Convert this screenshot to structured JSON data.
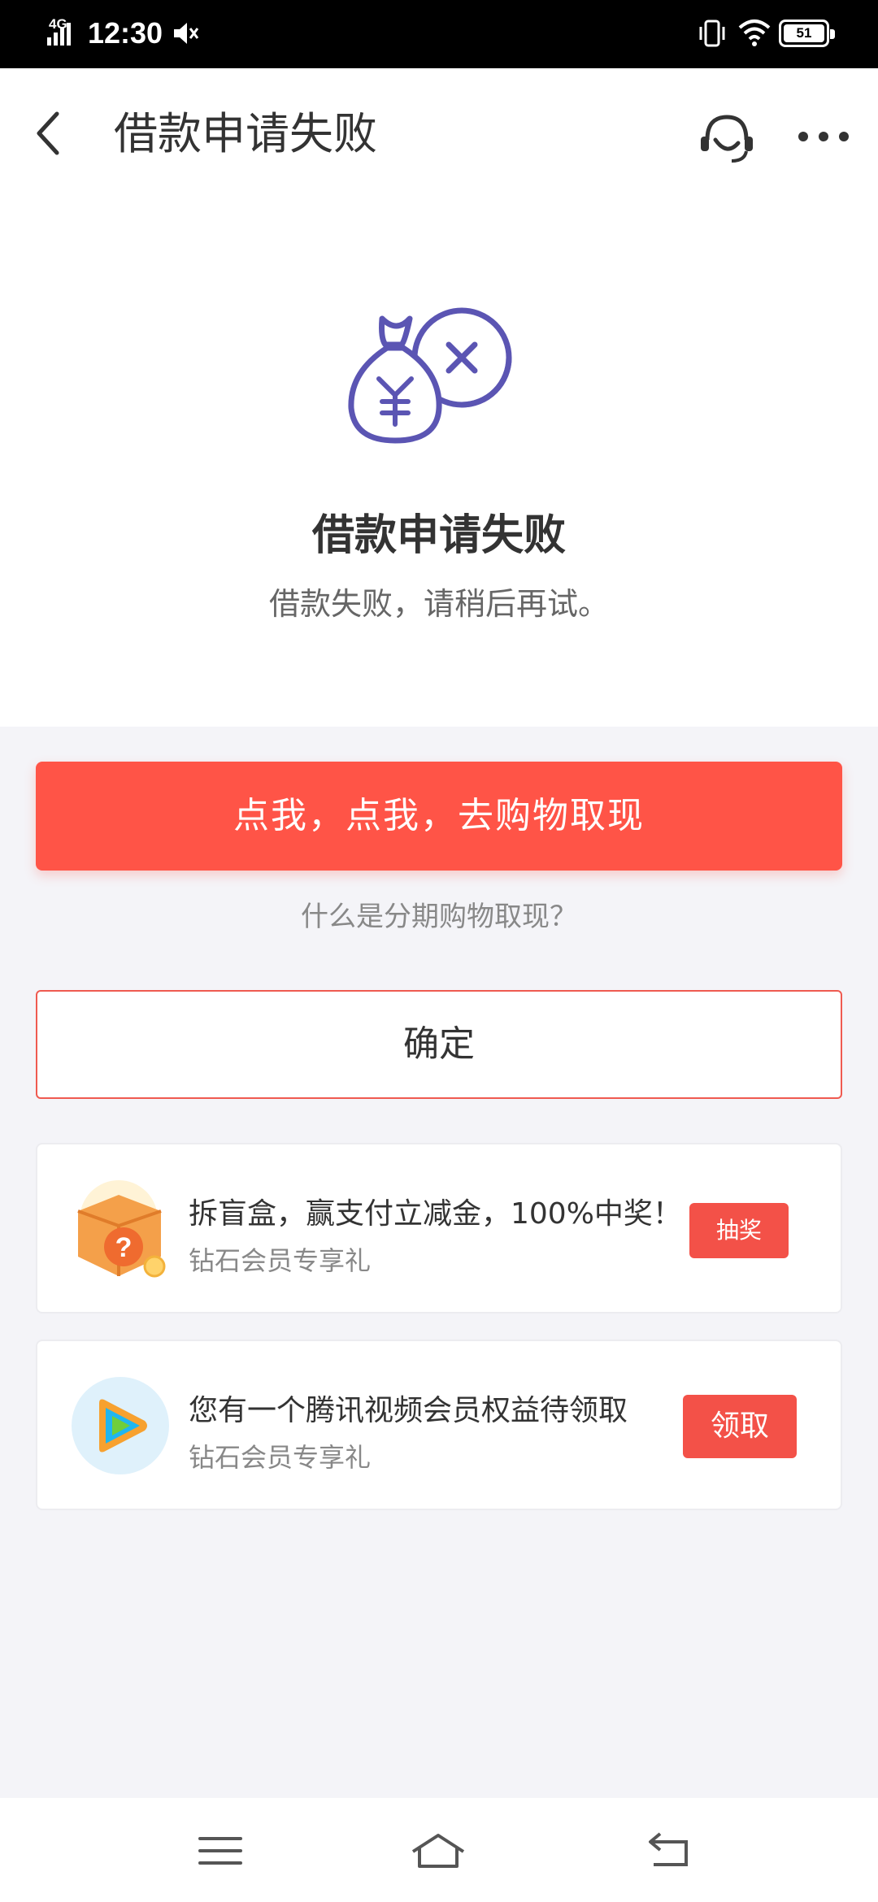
{
  "status_bar": {
    "network": "4G",
    "time": "12:30",
    "battery": "51"
  },
  "header": {
    "title": "借款申请失败",
    "icons": [
      "back-icon",
      "customer-service-icon",
      "more-icon"
    ]
  },
  "result": {
    "icon": "money-bag-failed-icon",
    "title": "借款申请失败",
    "description": "借款失败，请稍后再试。"
  },
  "actions": {
    "primary_label": "点我，点我，去购物取现",
    "help_link": "什么是分期购物取现？",
    "confirm_label": "确定"
  },
  "promos": [
    {
      "icon": "blind-box-icon",
      "title": "拆盲盒，赢支付立减金，100%中奖！",
      "subtitle": "钻石会员专享礼",
      "button": "抽奖"
    },
    {
      "icon": "tencent-video-icon",
      "title": "您有一个腾讯视频会员权益待领取",
      "subtitle": "钻石会员专享礼",
      "button": "领取"
    }
  ],
  "colors": {
    "accent": "#ff5447",
    "icon_purple": "#5b55b3",
    "page_bg": "#f4f4f8"
  },
  "nav": {
    "icons": [
      "menu-icon",
      "home-icon",
      "back-nav-icon"
    ]
  }
}
